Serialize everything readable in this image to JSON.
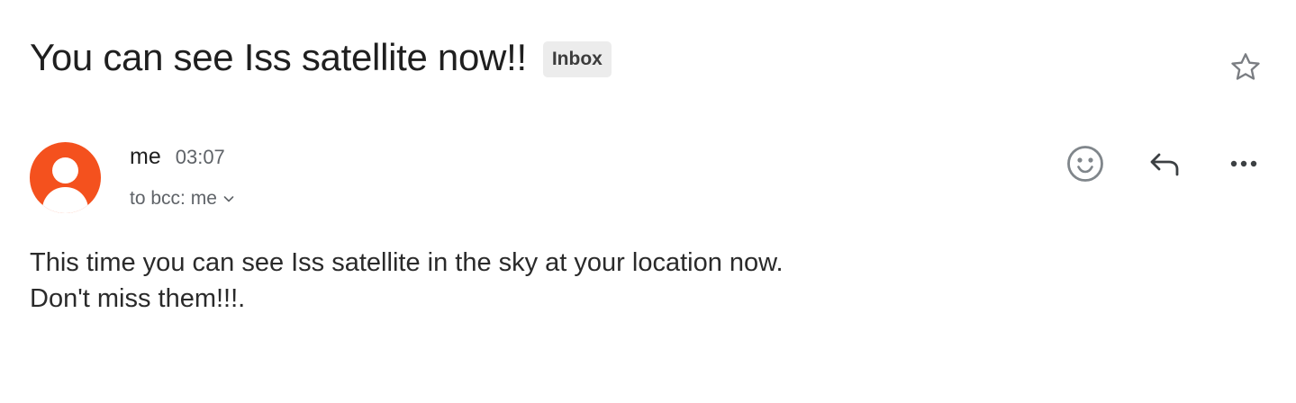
{
  "email": {
    "subject": "You can see Iss satellite now!!",
    "label": "Inbox",
    "sender": "me",
    "time": "03:07",
    "recipients": "to bcc: me",
    "body_lines": [
      "This time you can see Iss satellite in the sky at your location now.",
      "Don't miss them!!!."
    ]
  },
  "icons": {
    "star": "star-icon",
    "avatar": "person-icon",
    "expand": "chevron-down-icon",
    "emoji": "emoji-react-icon",
    "reply": "reply-icon",
    "more": "more-horizontal-icon"
  },
  "colors": {
    "avatar_bg": "#f4511e",
    "label_bg": "#ececec",
    "icon_gray": "#5f6368"
  }
}
